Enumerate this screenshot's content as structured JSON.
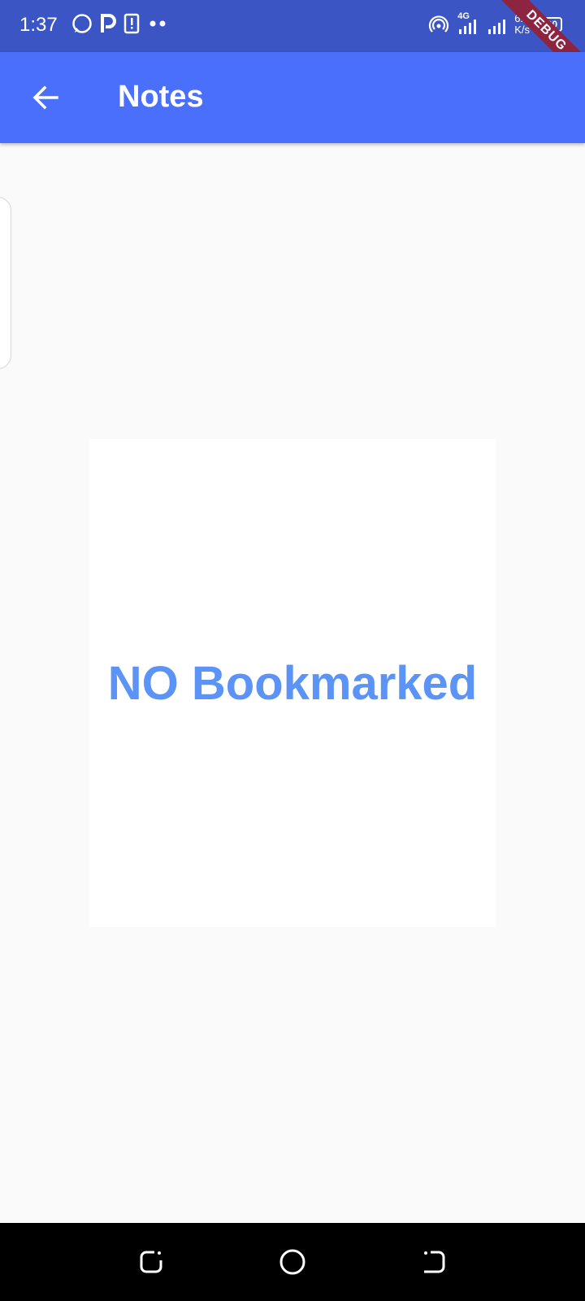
{
  "status_bar": {
    "time": "1:37",
    "network": "4G",
    "speed_top": "6.2",
    "speed_bottom": "K/s",
    "battery": "100",
    "icons": [
      "whatsapp-icon",
      "p-app-icon",
      "alert-icon",
      "dots-icon",
      "hotspot-icon",
      "signal-icon",
      "signal-icon",
      "battery-icon"
    ]
  },
  "debug_banner": "DEBUG",
  "app_bar": {
    "title": "Notes",
    "back_icon": "arrow-back-icon",
    "color": "#4a6ffb"
  },
  "empty_state": {
    "message": "NO Bookmarked",
    "color": "#5b94f6"
  },
  "nav_bar": {
    "icons": [
      "recents-icon",
      "home-icon",
      "back-icon"
    ]
  }
}
